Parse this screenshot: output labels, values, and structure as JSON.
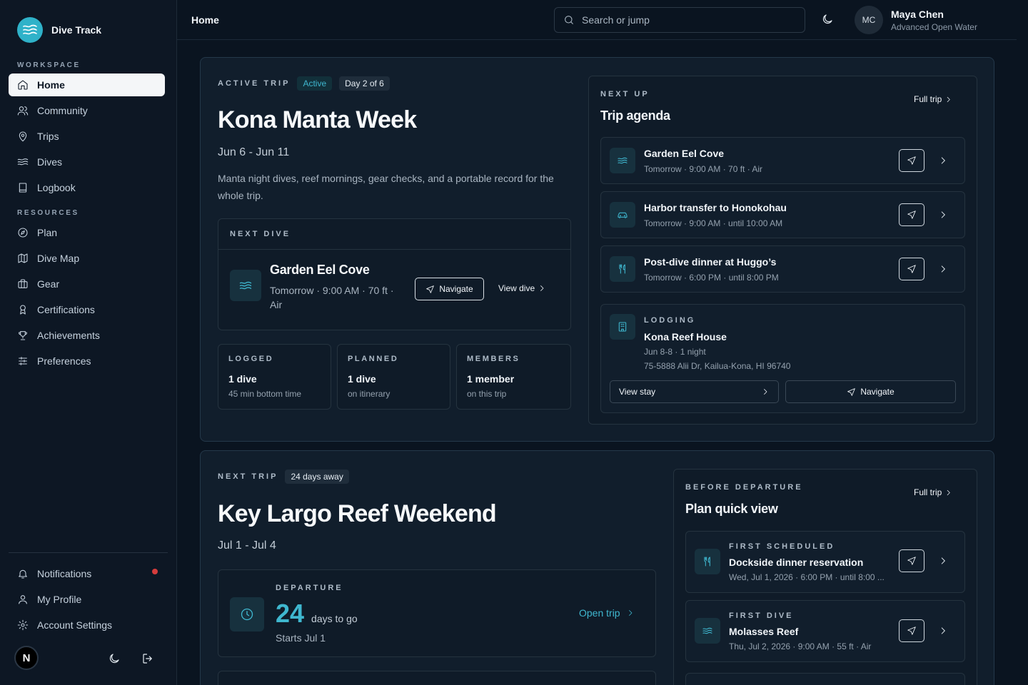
{
  "app": {
    "name": "Dive Track",
    "page_title": "Home"
  },
  "sidebar": {
    "workspace_label": "WORKSPACE",
    "resources_label": "RESOURCES",
    "workspace": [
      {
        "label": "Home",
        "icon": "home-icon"
      },
      {
        "label": "Community",
        "icon": "users-icon"
      },
      {
        "label": "Trips",
        "icon": "map-pin-icon"
      },
      {
        "label": "Dives",
        "icon": "waves-icon"
      },
      {
        "label": "Logbook",
        "icon": "book-icon"
      }
    ],
    "resources": [
      {
        "label": "Plan",
        "icon": "compass-icon"
      },
      {
        "label": "Dive Map",
        "icon": "map-icon"
      },
      {
        "label": "Gear",
        "icon": "briefcase-icon"
      },
      {
        "label": "Certifications",
        "icon": "award-icon"
      },
      {
        "label": "Achievements",
        "icon": "trophy-icon"
      },
      {
        "label": "Preferences",
        "icon": "sliders-icon"
      }
    ],
    "bottom": [
      {
        "label": "Notifications",
        "icon": "bell-icon"
      },
      {
        "label": "My Profile",
        "icon": "user-icon"
      },
      {
        "label": "Account Settings",
        "icon": "settings-icon"
      }
    ],
    "avatar_letter": "N"
  },
  "header": {
    "search_placeholder": "Search or jump",
    "user": {
      "initials": "MC",
      "name": "Maya Chen",
      "role": "Advanced Open Water"
    }
  },
  "active_trip": {
    "overline": "ACTIVE TRIP",
    "status": "Active",
    "day": "Day 2 of 6",
    "title": "Kona Manta Week",
    "dates": "Jun 6 - Jun 11",
    "description": "Manta night dives, reef mornings, gear checks, and a portable record for the whole trip.",
    "next_dive": {
      "overline": "NEXT DIVE",
      "name": "Garden Eel Cove",
      "details_line1": "Tomorrow · 9:00 AM · 70 ft ·",
      "details_line2": "Air",
      "navigate_label": "Navigate",
      "view_label": "View dive"
    },
    "stats": [
      {
        "label": "LOGGED",
        "value": "1 dive",
        "sub": "45 min bottom time"
      },
      {
        "label": "PLANNED",
        "value": "1 dive",
        "sub": "on itinerary"
      },
      {
        "label": "MEMBERS",
        "value": "1 member",
        "sub": "on this trip"
      }
    ],
    "agenda": {
      "overline": "NEXT UP",
      "title": "Trip agenda",
      "full_trip": "Full trip",
      "items": [
        {
          "title": "Garden Eel Cove",
          "sub": "Tomorrow · 9:00 AM · 70 ft · Air",
          "icon": "waves-icon"
        },
        {
          "title": "Harbor transfer to Honokohau",
          "sub": "Tomorrow · 9:00 AM · until 10:00 AM",
          "icon": "car-icon"
        },
        {
          "title": "Post-dive dinner at Huggo’s",
          "sub": "Tomorrow · 6:00 PM · until 8:00 PM",
          "icon": "utensils-icon"
        }
      ],
      "lodging": {
        "overline": "LODGING",
        "name": "Kona Reef House",
        "dates": "Jun 8-8 · 1 night",
        "address": "75-5888 Alii Dr, Kailua-Kona, HI 96740",
        "view_label": "View stay",
        "navigate_label": "Navigate"
      }
    }
  },
  "next_trip": {
    "overline": "NEXT TRIP",
    "badge": "24 days away",
    "title": "Key Largo Reef Weekend",
    "dates": "Jul 1 - Jul 4",
    "departure": {
      "overline": "DEPARTURE",
      "count": "24",
      "unit": "days to go",
      "starts": "Starts Jul 1",
      "open_label": "Open trip"
    },
    "plan": {
      "overline": "BEFORE DEPARTURE",
      "title": "Plan quick view",
      "full_trip": "Full trip",
      "items": [
        {
          "overline": "FIRST SCHEDULED",
          "title": "Dockside dinner reservation",
          "sub": "Wed, Jul 1, 2026 · 6:00 PM · until 8:00 ...",
          "icon": "utensils-icon"
        },
        {
          "overline": "FIRST DIVE",
          "title": "Molasses Reef",
          "sub": "Thu, Jul 2, 2026 · 9:00 AM · 55 ft · Air",
          "icon": "waves-icon"
        }
      ]
    }
  },
  "colors": {
    "accent": "#3fb7cf",
    "background": "#0a1420",
    "card": "#111e2c",
    "notification": "#d53c3c"
  }
}
